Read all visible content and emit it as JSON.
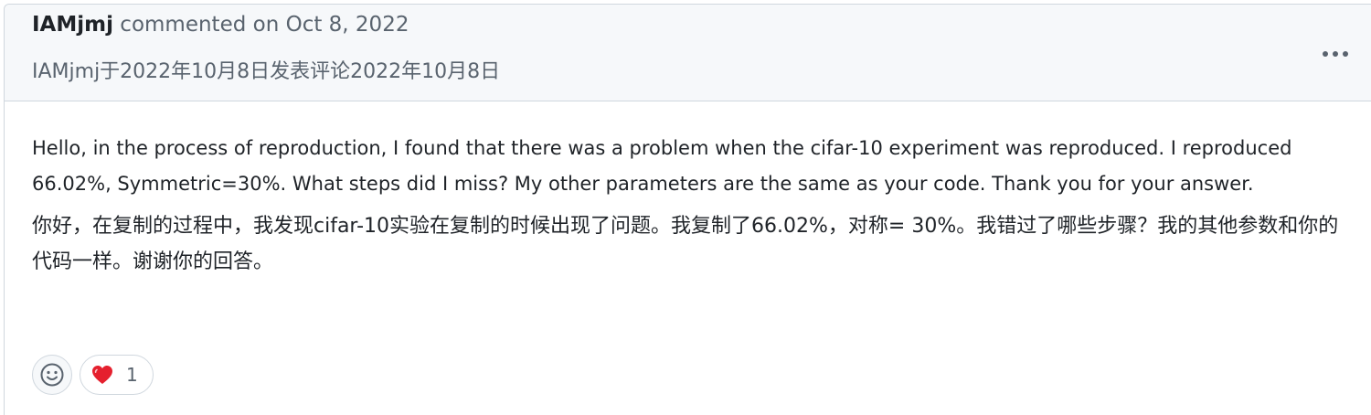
{
  "comment": {
    "author": "IAMjmj",
    "action_text": "commented on Oct 8, 2022",
    "translated_header": "IAMjmj于2022年10月8日发表评论2022年10月8日",
    "body_en": "Hello, in the process of reproduction, I found that there was a problem when the cifar-10 experiment was reproduced. I reproduced 66.02%, Symmetric=30%. What steps did I miss? My other parameters are the same as your code. Thank you for your answer.",
    "body_zh": "你好，在复制的过程中，我发现cifar-10实验在复制的时候出现了问题。我复制了66.02%，对称= 30%。我错过了哪些步骤？我的其他参数和你的代码一样。谢谢你的回答。",
    "more_icon": "kebab-horizontal-icon"
  },
  "reactions": {
    "add_icon": "smiley-icon",
    "items": [
      {
        "icon": "heart-icon",
        "count": "1",
        "color": "#e5202e"
      }
    ]
  },
  "colors": {
    "header_bg": "#f6f8fa",
    "border": "#d0d7de",
    "muted_text": "#59636e",
    "text": "#1f2328"
  }
}
